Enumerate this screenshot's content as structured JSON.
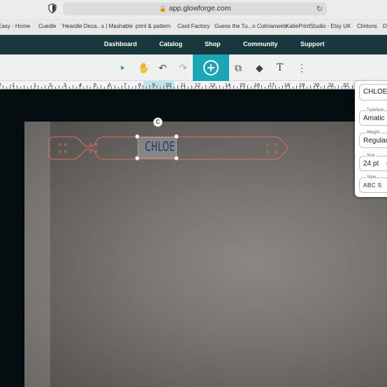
{
  "browser": {
    "url": "app.glowforge.com",
    "bookmarks": [
      "Easy - Home",
      "Cuedle",
      "'Heardle Deca...s | Mashable",
      "print & pattern",
      "Card Factory",
      "Guess the Tu...n Colmanweb",
      "KatiePrintStudio - Etsy UK",
      "Clintons",
      "D"
    ]
  },
  "nav": {
    "items": [
      "Dashboard",
      "Catalog",
      "Shop",
      "Community",
      "Support"
    ]
  },
  "toolbar": {
    "back": "‹",
    "select_icon": "▲",
    "pan_icon": "✋",
    "undo_icon": "↶",
    "redo_icon": "↷",
    "image_icon": "⧉",
    "shapes_icon": "◆",
    "text_icon": "T",
    "more_icon": "⋮"
  },
  "ruler": {
    "labels": [
      "2",
      "-1",
      "1",
      "2",
      "3",
      "4",
      "5",
      "6",
      "7",
      "8",
      "9",
      "10",
      "11",
      "12",
      "13",
      "14",
      "15",
      "16",
      "17",
      "18",
      "19",
      "20",
      "21",
      "22"
    ]
  },
  "design": {
    "text": "CHLOE",
    "rotate_glyph": "C"
  },
  "panel": {
    "text_value": "CHLOE",
    "typeface_label": "Typeface",
    "typeface_value": "Amatic",
    "weight_label": "Weight",
    "weight_value": "Regular",
    "size_label": "Size",
    "size_value": "24 pt",
    "size_chevron": "⌄",
    "style_label": "Style",
    "style_value": "ABC S"
  },
  "colors": {
    "nav_bg": "#18383d",
    "accent": "#1aa6b7",
    "cut_line": "#e0705a",
    "text_fill": "#26306a"
  }
}
